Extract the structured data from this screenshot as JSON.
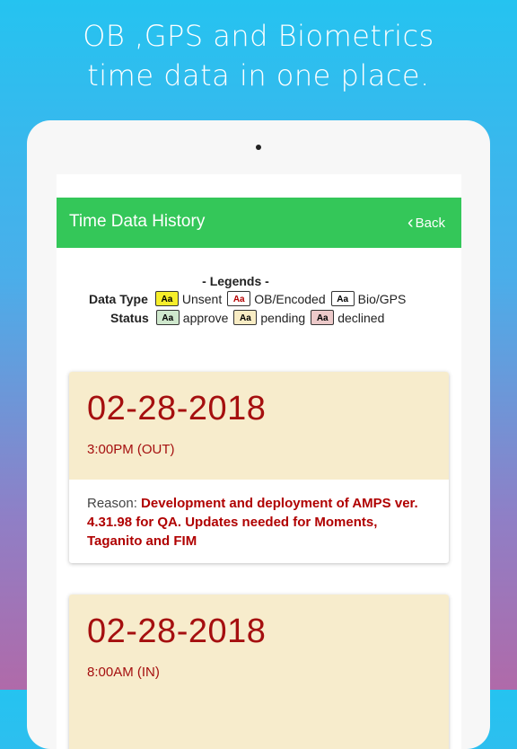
{
  "promo": {
    "line1": "OB ,GPS and Biometrics",
    "line2": "time data in one place."
  },
  "appbar": {
    "title": "Time Data History",
    "back_label": "Back"
  },
  "legends": {
    "title": "- Legends -",
    "data_type_label": "Data Type",
    "status_label": "Status",
    "chip_text": "Aa",
    "data_types": [
      {
        "label": "Unsent",
        "color": "#f6ee2a"
      },
      {
        "label": "OB/Encoded",
        "color": "#ffffff"
      },
      {
        "label": "Bio/GPS",
        "color": "#ffffff"
      }
    ],
    "statuses": [
      {
        "label": "approve",
        "color": "#cfe8cd"
      },
      {
        "label": "pending",
        "color": "#f8ecc4"
      },
      {
        "label": "declined",
        "color": "#ecc9c9"
      }
    ]
  },
  "records": [
    {
      "date": "02-28-2018",
      "time": "3:00PM (OUT)",
      "reason_label": "Reason:",
      "reason": "Development and deployment of AMPS ver. 4.31.98 for QA. Updates needed for Moments, Taganito and FIM"
    },
    {
      "date": "02-28-2018",
      "time": "8:00AM (IN)"
    }
  ],
  "colors": {
    "appbar": "#34c759",
    "date_text": "#a50f0f",
    "card_header": "#f7eccc"
  }
}
